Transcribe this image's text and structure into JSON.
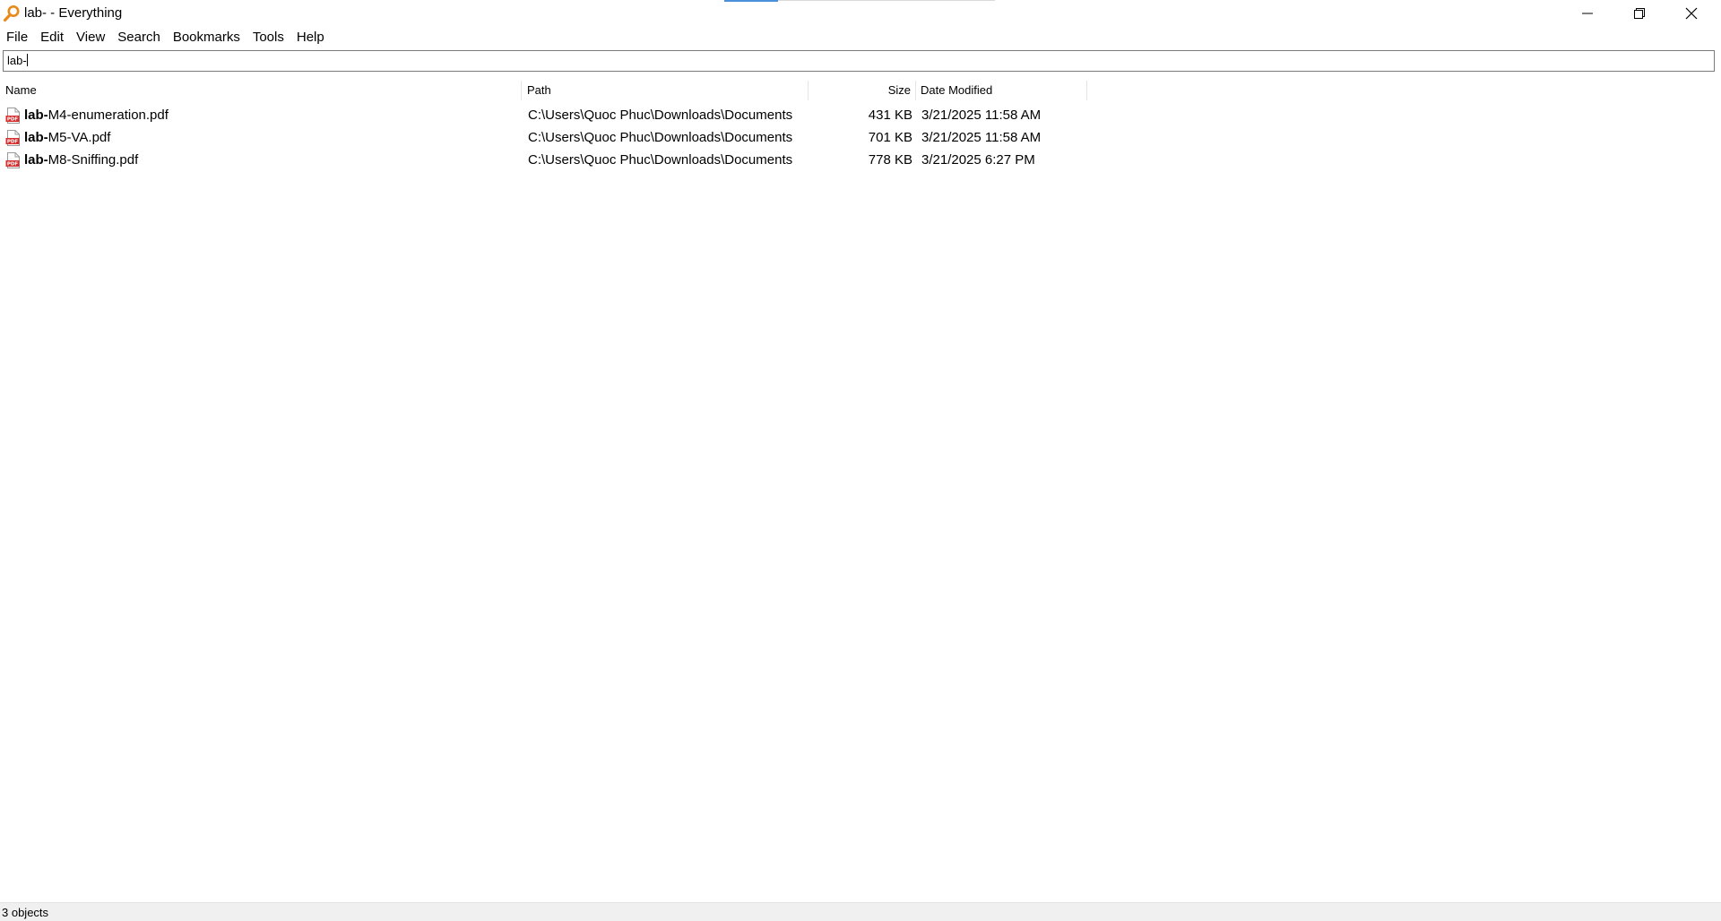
{
  "window": {
    "title": "lab- - Everything",
    "app_icon": "magnifier-icon",
    "controls": [
      "minimize-icon",
      "restore-icon",
      "close-icon"
    ]
  },
  "menu": [
    "File",
    "Edit",
    "View",
    "Search",
    "Bookmarks",
    "Tools",
    "Help"
  ],
  "search": {
    "value": "lab-"
  },
  "columns": {
    "name": "Name",
    "path": "Path",
    "size": "Size",
    "date": "Date Modified"
  },
  "results": [
    {
      "match": "lab-",
      "rest": "M4-enumeration.pdf",
      "path": "C:\\Users\\Quoc Phuc\\Downloads\\Documents",
      "size": "431 KB",
      "date": "3/21/2025 11:58 AM",
      "icon": "pdf-file-icon"
    },
    {
      "match": "lab-",
      "rest": "M5-VA.pdf",
      "path": "C:\\Users\\Quoc Phuc\\Downloads\\Documents",
      "size": "701 KB",
      "date": "3/21/2025 11:58 AM",
      "icon": "pdf-file-icon"
    },
    {
      "match": "lab-",
      "rest": "M8-Sniffing.pdf",
      "path": "C:\\Users\\Quoc Phuc\\Downloads\\Documents",
      "size": "778 KB",
      "date": "3/21/2025 6:27 PM",
      "icon": "pdf-file-icon"
    }
  ],
  "status": "3 objects",
  "colors": {
    "pdf_red": "#d32f2f",
    "accent": "#4a90d9",
    "icon_orange": "#e8891a"
  }
}
